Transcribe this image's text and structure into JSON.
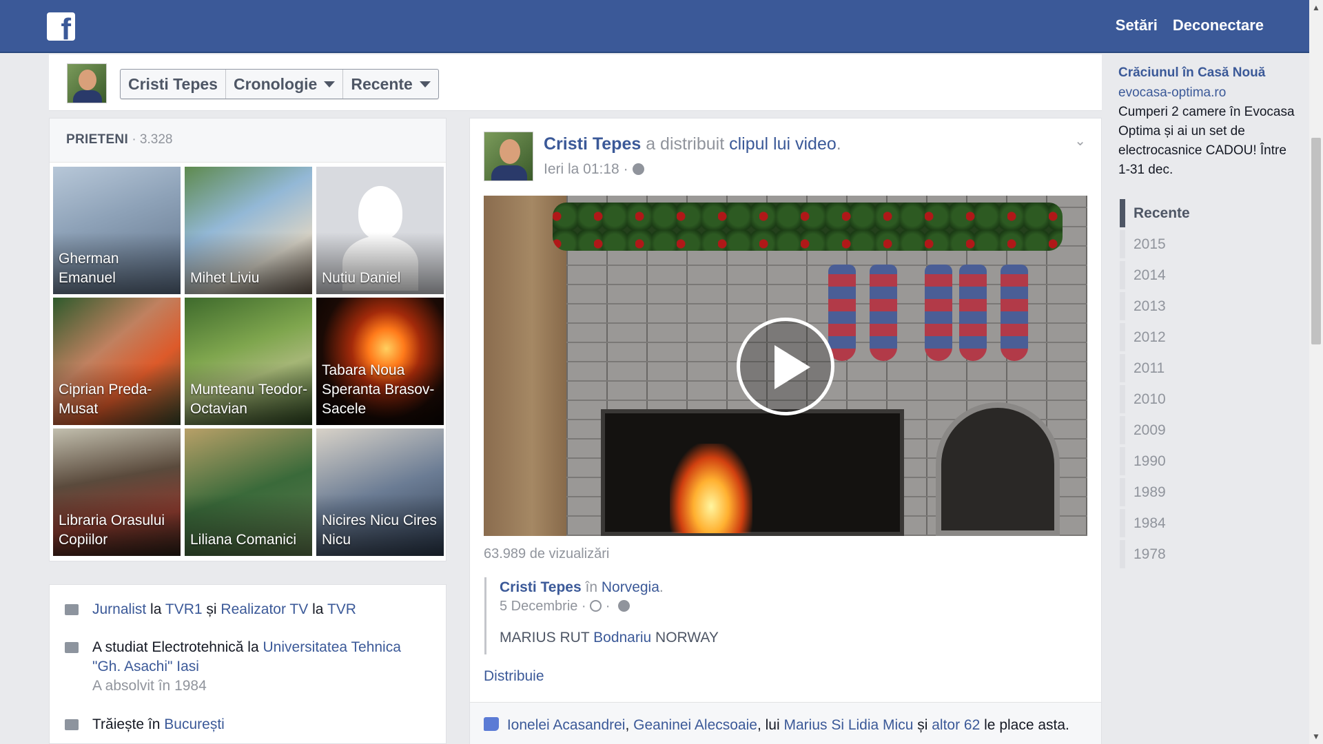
{
  "topbar": {
    "settings": "Setări",
    "logout": "Deconectare",
    "logo_icon": "facebook-logo"
  },
  "header": {
    "crumbs": [
      {
        "label": "Cristi Tepes"
      },
      {
        "label": "Cronologie"
      },
      {
        "label": "Recente"
      }
    ]
  },
  "friends": {
    "title": "PRIETENI",
    "count": "· 3.328",
    "items": [
      {
        "name": "Gherman Emanuel"
      },
      {
        "name": "Mihet Liviu"
      },
      {
        "name": "Nutiu Daniel"
      },
      {
        "name": "Ciprian Preda-Musat"
      },
      {
        "name": "Munteanu Teodor-Octavian"
      },
      {
        "name": "Tabara Noua Speranta Brasov-Sacele"
      },
      {
        "name": "Libraria Orasului Copiilor"
      },
      {
        "name": "Liliana Comanici"
      },
      {
        "name": "Nicires Nicu Cires Nicu"
      }
    ]
  },
  "about": {
    "work": {
      "job": "Jurnalist",
      "la1": "la",
      "org1": "TVR1",
      "si": "și",
      "job2": "Realizator TV",
      "la2": "la",
      "org2": "TVR"
    },
    "edu": {
      "prefix": "A studiat Electrotehnică la",
      "school": "Universitatea Tehnica \"Gh. Asachi\" Iasi",
      "grad": "A absolvit în 1984"
    },
    "home": {
      "prefix": "Trăiește în",
      "city": "București"
    }
  },
  "post": {
    "author": "Cristi Tepes",
    "action": "a distribuit",
    "link": "clipul lui video",
    "period": ".",
    "time": "Ieri la 01:18 ·",
    "views": "63.989 de vizualizări",
    "shared": {
      "author": "Cristi Tepes",
      "in": "în",
      "place": "Norvegia",
      "period": ".",
      "date": "5 Decembrie ·",
      "dot": "·",
      "text_a": "MARIUS RUT",
      "text_link": "Bodnariu",
      "text_b": "NORWAY"
    },
    "share_label": "Distribuie",
    "likes": {
      "p1": "Ionelei Acasandrei",
      "comma1": ",",
      "p2": "Geaninei Alecsoaie",
      "comma2": ", lui",
      "p3": "Marius Si Lidia Micu",
      "and": "și",
      "others": "altor 62",
      "suffix": "le place asta."
    }
  },
  "ad": {
    "title": "Crăciunul în Casă Nouă",
    "url": "evocasa-optima.ro",
    "text": "Cumperi 2 camere în Evocasa Optima și ai un set de electrocasnice CADOU! Între 1-31 dec."
  },
  "years": [
    {
      "label": "Recente"
    },
    {
      "label": "2015"
    },
    {
      "label": "2014"
    },
    {
      "label": "2013"
    },
    {
      "label": "2012"
    },
    {
      "label": "2011"
    },
    {
      "label": "2010"
    },
    {
      "label": "2009"
    },
    {
      "label": "1990"
    },
    {
      "label": "1989"
    },
    {
      "label": "1984"
    },
    {
      "label": "1978"
    }
  ],
  "colors": {
    "brand": "#3b5998",
    "background": "#e9eaed"
  }
}
